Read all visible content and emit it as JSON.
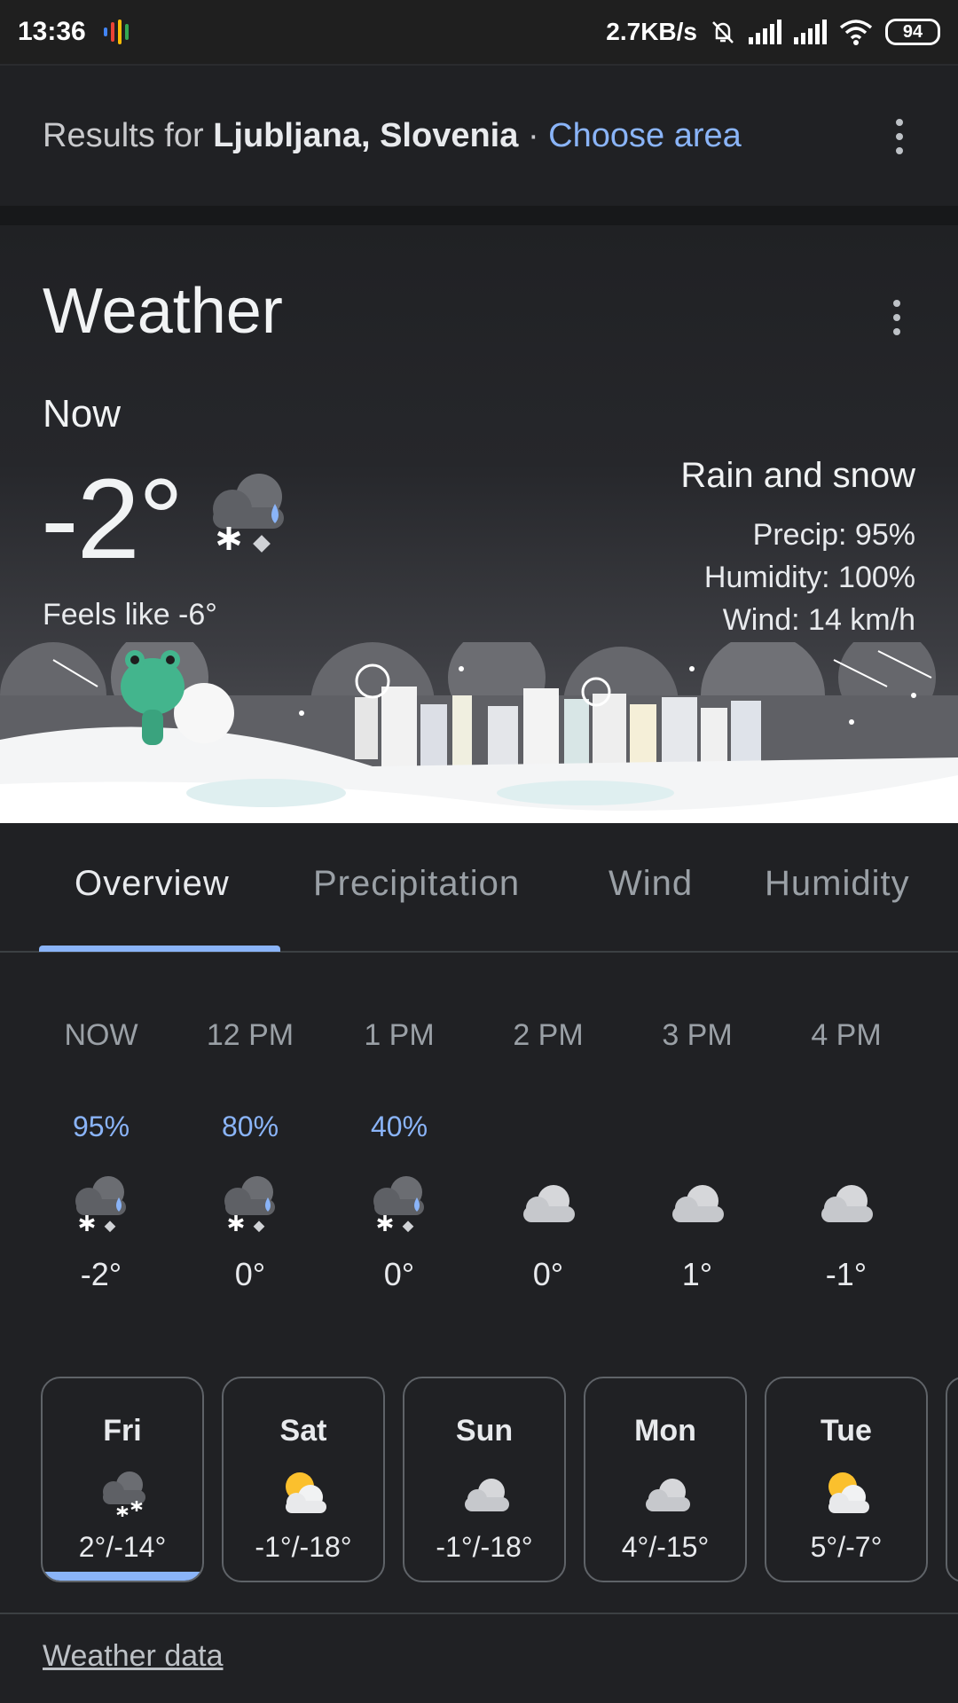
{
  "status_bar": {
    "time": "13:36",
    "net_speed": "2.7KB/s",
    "battery": "94",
    "icons": [
      "assistant-icon",
      "bell-off-icon",
      "signal-icon",
      "signal-roaming-icon",
      "wifi-icon",
      "battery-icon"
    ]
  },
  "results": {
    "prefix": "Results for",
    "location": "Ljubljana, Slovenia",
    "separator": "·",
    "choose_area": "Choose area"
  },
  "weather": {
    "title": "Weather",
    "now_label": "Now",
    "temperature": "-2°",
    "feels_like": "Feels like -6°",
    "condition": "Rain and snow",
    "precip": "Precip: 95%",
    "humidity": "Humidity: 100%",
    "wind": "Wind: 14 km/h"
  },
  "tabs": [
    {
      "label": "Overview",
      "active": true
    },
    {
      "label": "Precipitation",
      "active": false
    },
    {
      "label": "Wind",
      "active": false
    },
    {
      "label": "Humidity",
      "active": false
    }
  ],
  "hourly": [
    {
      "time": "NOW",
      "precip": "95%",
      "icon": "rain-snow-icon",
      "temp": "-2°"
    },
    {
      "time": "12 PM",
      "precip": "80%",
      "icon": "rain-snow-icon",
      "temp": "0°"
    },
    {
      "time": "1 PM",
      "precip": "40%",
      "icon": "rain-snow-icon",
      "temp": "0°"
    },
    {
      "time": "2 PM",
      "precip": "",
      "icon": "cloudy-icon",
      "temp": "0°"
    },
    {
      "time": "3 PM",
      "precip": "",
      "icon": "cloudy-icon",
      "temp": "1°"
    },
    {
      "time": "4 PM",
      "precip": "",
      "icon": "cloudy-icon",
      "temp": "-1°"
    }
  ],
  "daily": [
    {
      "day": "Fri",
      "icon": "snow-icon",
      "temps": "2°/-14°",
      "selected": true
    },
    {
      "day": "Sat",
      "icon": "partly-cloudy-icon",
      "temps": "-1°/-18°",
      "selected": false
    },
    {
      "day": "Sun",
      "icon": "cloudy-icon",
      "temps": "-1°/-18°",
      "selected": false
    },
    {
      "day": "Mon",
      "icon": "cloudy-icon",
      "temps": "4°/-15°",
      "selected": false
    },
    {
      "day": "Tue",
      "icon": "partly-cloudy-icon",
      "temps": "5°/-7°",
      "selected": false
    }
  ],
  "footer": {
    "link": "Weather data"
  },
  "colors": {
    "accent": "#8ab4f8",
    "background": "#202124"
  }
}
